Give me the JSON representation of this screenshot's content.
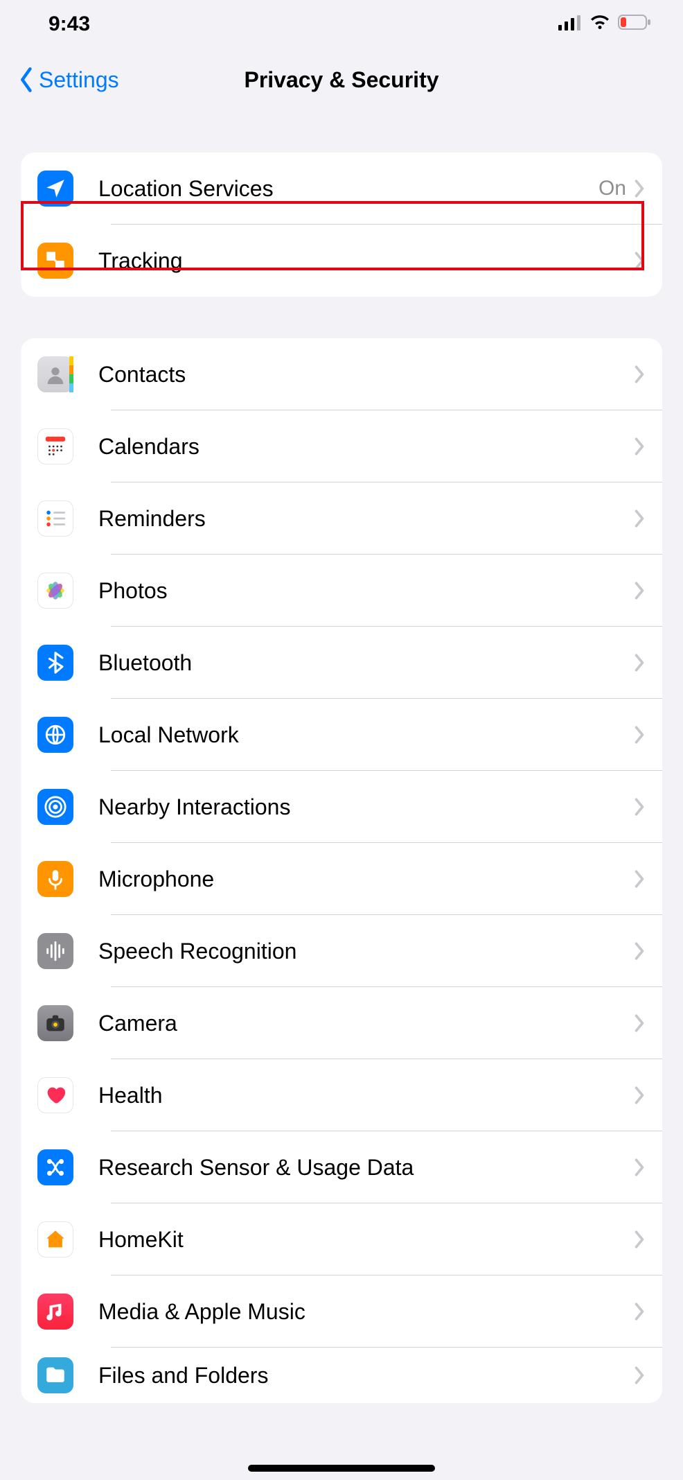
{
  "status_bar": {
    "time": "9:43"
  },
  "nav": {
    "back_label": "Settings",
    "title": "Privacy & Security"
  },
  "groups": [
    {
      "rows": [
        {
          "id": "location-services",
          "icon": "location",
          "icon_bg": "#007aff",
          "label": "Location Services",
          "detail": "On",
          "highlight": true
        },
        {
          "id": "tracking",
          "icon": "tracking",
          "icon_bg": "#ff9500",
          "label": "Tracking"
        }
      ]
    },
    {
      "rows": [
        {
          "id": "contacts",
          "icon": "contacts",
          "icon_bg": "#d8d8dc",
          "label": "Contacts"
        },
        {
          "id": "calendars",
          "icon": "calendars",
          "icon_bg": "#ffffff",
          "label": "Calendars"
        },
        {
          "id": "reminders",
          "icon": "reminders",
          "icon_bg": "#ffffff",
          "label": "Reminders"
        },
        {
          "id": "photos",
          "icon": "photos",
          "icon_bg": "#ffffff",
          "label": "Photos"
        },
        {
          "id": "bluetooth",
          "icon": "bluetooth",
          "icon_bg": "#007aff",
          "label": "Bluetooth"
        },
        {
          "id": "local-network",
          "icon": "globe",
          "icon_bg": "#007aff",
          "label": "Local Network"
        },
        {
          "id": "nearby-interactions",
          "icon": "nearby",
          "icon_bg": "#007aff",
          "label": "Nearby Interactions"
        },
        {
          "id": "microphone",
          "icon": "microphone",
          "icon_bg": "#ff9500",
          "label": "Microphone"
        },
        {
          "id": "speech-recognition",
          "icon": "speech",
          "icon_bg": "#8e8e93",
          "label": "Speech Recognition"
        },
        {
          "id": "camera",
          "icon": "camera",
          "icon_bg": "#8e8e93",
          "label": "Camera"
        },
        {
          "id": "health",
          "icon": "health",
          "icon_bg": "#ffffff",
          "label": "Health"
        },
        {
          "id": "research",
          "icon": "research",
          "icon_bg": "#007aff",
          "label": "Research Sensor & Usage Data"
        },
        {
          "id": "homekit",
          "icon": "homekit",
          "icon_bg": "#ffffff",
          "label": "HomeKit"
        },
        {
          "id": "media",
          "icon": "media",
          "icon_bg": "#fc3158",
          "label": "Media & Apple Music"
        },
        {
          "id": "files-folders",
          "icon": "files",
          "icon_bg": "#34aadc",
          "label": "Files and Folders"
        }
      ]
    }
  ]
}
